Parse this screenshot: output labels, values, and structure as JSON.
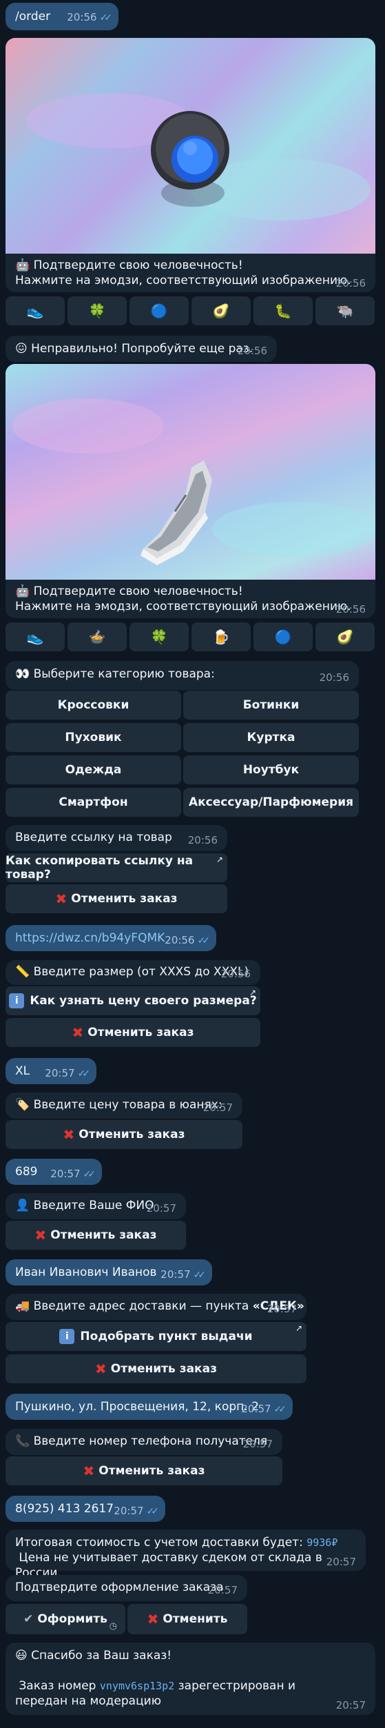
{
  "messages": {
    "order_cmd": {
      "text": "/order",
      "time": "20:56"
    },
    "captcha1": {
      "line1": "Подтвердите свою человечность!",
      "line2": "Нажмите на эмодзи, соответствующий изображению.",
      "time": "20:56",
      "image": "round-button-emoji",
      "emojis": [
        "👟",
        "🍀",
        "🔵",
        "🥑",
        "🐛",
        "🐃"
      ]
    },
    "wrong": {
      "text": "Неправильно! Попробуйте еще раз.",
      "time": "20:56"
    },
    "captcha2": {
      "line1": "Подтвердите свою человечность!",
      "line2": "Нажмите на эмодзи, соответствующий изображению.",
      "time": "20:56",
      "image": "sneaker-emoji",
      "emojis": [
        "👟",
        "🍲",
        "🍀",
        "🍺",
        "🔵",
        "🥑"
      ]
    },
    "category": {
      "text": "Выберите категорию товара:",
      "time": "20:56",
      "buttons": [
        "Кроссовки",
        "Ботинки",
        "Пуховик",
        "Куртка",
        "Одежда",
        "Ноутбук",
        "Смартфон",
        "Аксессуар/Парфюмерия"
      ]
    },
    "link_prompt": {
      "text": "Введите ссылку на товар",
      "time": "20:56",
      "how_button": "Как скопировать ссылку на товар?",
      "cancel": "Отменить заказ"
    },
    "link_reply": {
      "text": "https://dwz.cn/b94yFQMK",
      "time": "20:56"
    },
    "size_prompt": {
      "text": "Введите размер (от XXXS до XXXL)",
      "time": "20:56",
      "info_button": "Как узнать цену своего размера?",
      "cancel": "Отменить заказ"
    },
    "size_reply": {
      "text": "XL",
      "time": "20:57"
    },
    "price_prompt": {
      "text": "Введите цену товара в юанях:",
      "time": "20:57",
      "cancel": "Отменить заказ"
    },
    "price_reply": {
      "text": "689",
      "time": "20:57"
    },
    "name_prompt": {
      "text": "Введите Ваше ФИО",
      "time": "20:57",
      "cancel": "Отменить заказ"
    },
    "name_reply": {
      "text": "Иван Иванович Иванов",
      "time": "20:57"
    },
    "address_prompt": {
      "text": "Введите адрес доставки — пункта ",
      "bold": "«СДЕК»",
      "time": "20:57",
      "pick_button": "Подобрать пункт выдачи",
      "cancel": "Отменить заказ"
    },
    "address_reply": {
      "text": "Пушкино, ул. Просвещения, 12, корп. 2",
      "time": "20:57"
    },
    "phone_prompt": {
      "text": "Введите номер телефона получателя",
      "time": "20:57",
      "cancel": "Отменить заказ"
    },
    "phone_reply": {
      "text": "8(925) 413 2617",
      "time": "20:57"
    },
    "total": {
      "line1": "Итоговая стоимость с учетом доставки будет: ",
      "amount": "9936₽",
      "line2": "Цена не учитывает доставку сдеком от склада в России.",
      "time": "20:57"
    },
    "confirm": {
      "text": "Подтвердите оформление заказа",
      "time": "20:57",
      "ok": "Оформить",
      "cancel": "Отменить"
    },
    "thanks": {
      "line1": "Спасибо за Ваш заказ!",
      "line2a": "Заказ номер ",
      "order_id": "vnymv6sp13p2",
      "line2b": " зарегестрирован и передан на модерацию",
      "time": "20:57"
    }
  },
  "icons": {
    "robot": "robot-icon",
    "eyes": "eyes-icon",
    "ruler": "ruler-icon",
    "tag": "price-tag-icon",
    "person": "person-icon",
    "truck": "truck-icon",
    "phone": "phone-icon",
    "smile": "smile-icon",
    "sad": "sad-face-icon"
  },
  "colors": {
    "background": "#0e1621",
    "incoming": "#182533",
    "outgoing": "#2b5278",
    "button": "#1f2d3b",
    "cancel_x": "#e0342f"
  }
}
